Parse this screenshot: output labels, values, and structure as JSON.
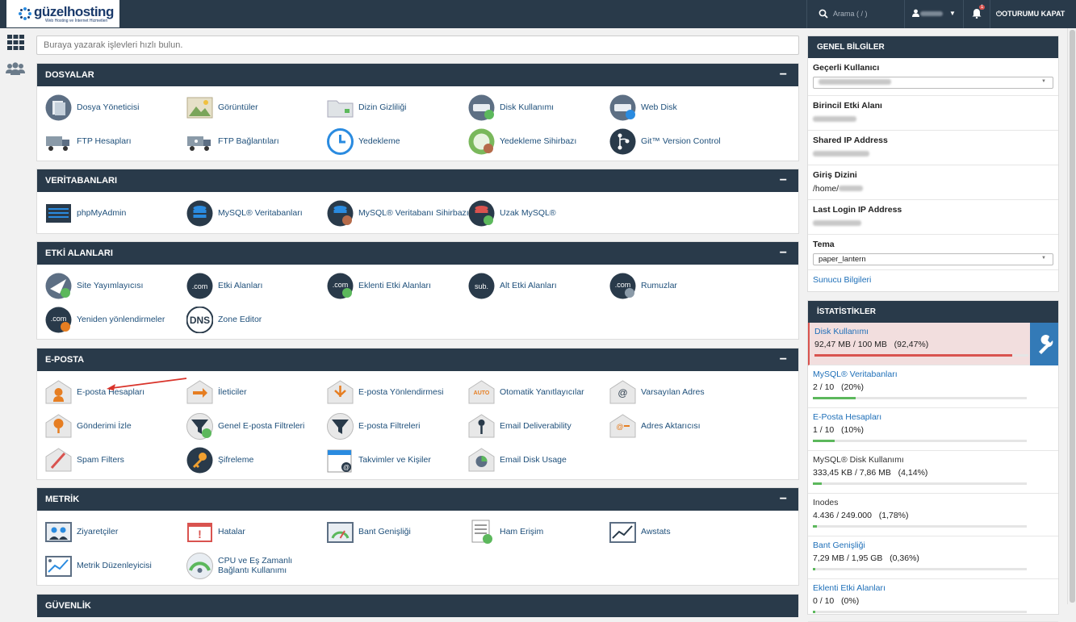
{
  "topbar": {
    "brand": "güzelhosting",
    "brand_sub": "Web Hosting ve İnternet Hizmetleri",
    "search_placeholder": "Arama ( / )",
    "notification_count": "1",
    "logout_label": "OTURUMU KAPAT"
  },
  "quickfind": {
    "placeholder": "Buraya yazarak işlevleri hızlı bulun."
  },
  "sections": {
    "files": {
      "title": "DOSYALAR",
      "items": [
        "Dosya Yöneticisi",
        "Görüntüler",
        "Dizin Gizliliği",
        "Disk Kullanımı",
        "Web Disk",
        "FTP Hesapları",
        "FTP Bağlantıları",
        "Yedekleme",
        "Yedekleme Sihirbazı",
        "Git™ Version Control"
      ]
    },
    "databases": {
      "title": "VERİTABANLARI",
      "items": [
        "phpMyAdmin",
        "MySQL® Veritabanları",
        "MySQL® Veritabanı Sihirbazı",
        "Uzak MySQL®"
      ]
    },
    "domains": {
      "title": "ETKİ ALANLARI",
      "items": [
        "Site Yayımlayıcısı",
        "Etki Alanları",
        "Eklenti Etki Alanları",
        "Alt Etki Alanları",
        "Rumuzlar",
        "Yeniden yönlendirmeler",
        "Zone Editor"
      ]
    },
    "email": {
      "title": "E-POSTA",
      "items": [
        "E-posta Hesapları",
        "İleticiler",
        "E-posta Yönlendirmesi",
        "Otomatik Yanıtlayıcılar",
        "Varsayılan Adres",
        "Gönderimi İzle",
        "Genel E-posta Filtreleri",
        "E-posta Filtreleri",
        "Email Deliverability",
        "Adres Aktarıcısı",
        "Spam Filters",
        "Şifreleme",
        "Takvimler ve Kişiler",
        "Email Disk Usage"
      ]
    },
    "metrics": {
      "title": "METRİK",
      "items": [
        "Ziyaretçiler",
        "Hatalar",
        "Bant Genişliği",
        "Ham Erişim",
        "Awstats",
        "Metrik Düzenleyicisi",
        "CPU ve Eş Zamanlı Bağlantı Kullanımı"
      ]
    },
    "security": {
      "title": "GÜVENLİK"
    }
  },
  "general_info": {
    "title": "GENEL BİLGİLER",
    "current_user_label": "Geçerli Kullanıcı",
    "primary_domain_label": "Birincil Etki Alanı",
    "shared_ip_label": "Shared IP Address",
    "home_dir_label": "Giriş Dizini",
    "home_dir_prefix": "/home/",
    "last_login_label": "Last Login IP Address",
    "theme_label": "Tema",
    "theme_value": "paper_lantern",
    "server_info_link": "Sunucu Bilgileri"
  },
  "stats": {
    "title": "İSTATİSTİKLER",
    "items": [
      {
        "label": "Disk Kullanımı",
        "value": "92,47 MB / 100 MB   (92,47%)",
        "percent": 92.47,
        "color": "#d9534f",
        "link": true,
        "alert": true
      },
      {
        "label": "MySQL® Veritabanları",
        "value": "2 / 10   (20%)",
        "percent": 20,
        "color": "#5cb85c",
        "link": true
      },
      {
        "label": "E-Posta Hesapları",
        "value": "1 / 10   (10%)",
        "percent": 10,
        "color": "#5cb85c",
        "link": true
      },
      {
        "label": "MySQL® Disk Kullanımı",
        "value": "333,45 KB / 7,86 MB   (4,14%)",
        "percent": 4.14,
        "color": "#5cb85c",
        "link": false
      },
      {
        "label": "Inodes",
        "value": "4.436 / 249.000   (1,78%)",
        "percent": 1.78,
        "color": "#5cb85c",
        "link": false
      },
      {
        "label": "Bant Genişliği",
        "value": "7,29 MB / 1,95 GB   (0,36%)",
        "percent": 0.36,
        "color": "#5cb85c",
        "link": true
      },
      {
        "label": "Eklenti Etki Alanları",
        "value": "0 / 10   (0%)",
        "percent": 0,
        "color": "#5cb85c",
        "link": true
      }
    ]
  }
}
